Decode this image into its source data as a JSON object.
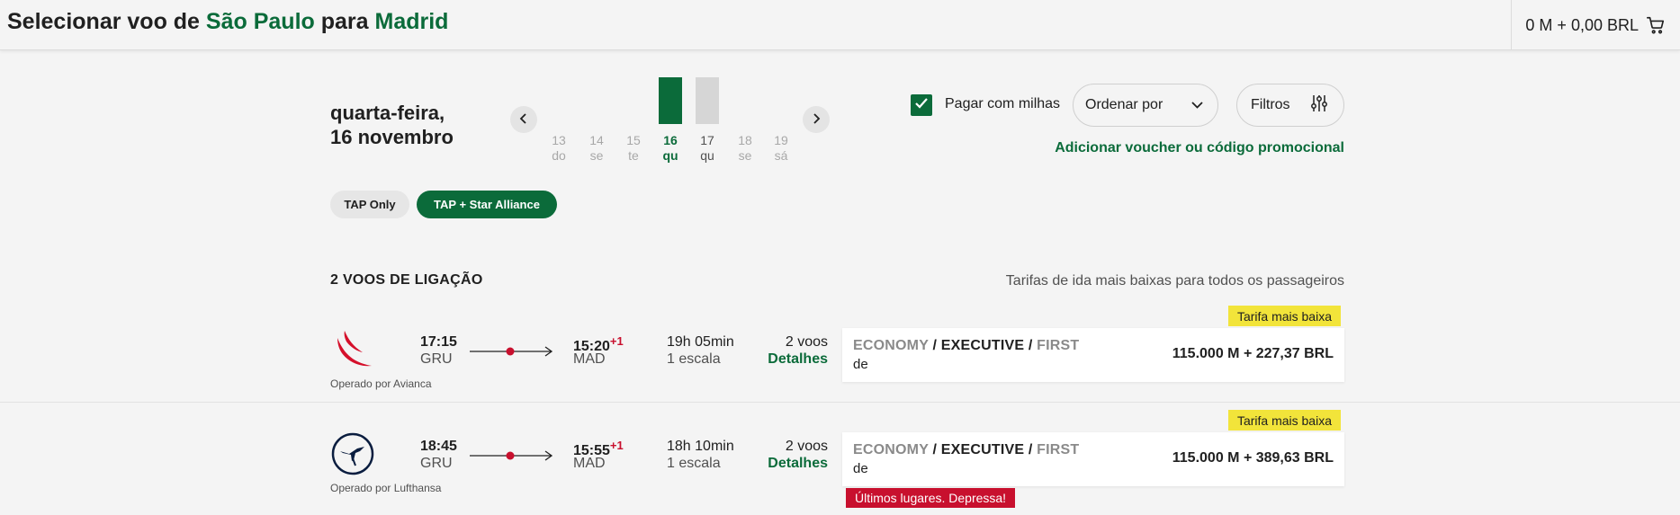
{
  "header": {
    "title_prefix": "Selecionar voo de ",
    "origin": "São Paulo",
    "title_mid": " para ",
    "destination": "Madrid",
    "cart_total": "0 M + 0,00 BRL",
    "cart_icon": "shopping-cart-icon"
  },
  "date_selector": {
    "weekday": "quarta-feira,",
    "date": "16 novembro",
    "days": [
      {
        "num": "13",
        "abbr": "do"
      },
      {
        "num": "14",
        "abbr": "se"
      },
      {
        "num": "15",
        "abbr": "te"
      },
      {
        "num": "16",
        "abbr": "qu"
      },
      {
        "num": "17",
        "abbr": "qu"
      },
      {
        "num": "18",
        "abbr": "se"
      },
      {
        "num": "19",
        "abbr": "sá"
      }
    ],
    "prev_icon": "chevron-left-icon",
    "next_icon": "chevron-right-icon"
  },
  "controls": {
    "pay_with_miles_label": "Pagar com milhas",
    "pay_with_miles_checked": true,
    "sort_label": "Ordenar por",
    "filters_label": "Filtros",
    "voucher_link": "Adicionar voucher ou código promocional"
  },
  "alliance": {
    "tap_only": "TAP Only",
    "tap_star": "TAP + Star Alliance"
  },
  "results": {
    "section_title": "2 VOOS DE LIGAÇÃO",
    "note": "Tarifas de ida mais baixas para todos os passageiros",
    "flights": [
      {
        "logo": "avianca-logo-icon",
        "operated_by": "Operado por Avianca",
        "dep_time": "17:15",
        "dep_code": "GRU",
        "arr_time": "15:20",
        "day_offset": "+1",
        "arr_code": "MAD",
        "duration": "19h 05min",
        "stops": "1 escala",
        "flights_count": "2 voos",
        "details": "Detalhes",
        "cabin_economy": "ECONOMY",
        "cabin_executive": "EXECUTIVE",
        "cabin_first": "FIRST",
        "sep": " / ",
        "from_label": "de",
        "price": "115.000 M + 227,37 BRL",
        "badge": "Tarifa mais baixa"
      },
      {
        "logo": "lufthansa-logo-icon",
        "operated_by": "Operado por Lufthansa",
        "dep_time": "18:45",
        "dep_code": "GRU",
        "arr_time": "15:55",
        "day_offset": "+1",
        "arr_code": "MAD",
        "duration": "18h 10min",
        "stops": "1 escala",
        "flights_count": "2 voos",
        "details": "Detalhes",
        "cabin_economy": "ECONOMY",
        "cabin_executive": "EXECUTIVE",
        "cabin_first": "FIRST",
        "sep": " / ",
        "from_label": "de",
        "price": "115.000 M + 389,63 BRL",
        "badge": "Tarifa mais baixa",
        "urgency": "Últimos lugares. Depressa!"
      }
    ]
  },
  "colors": {
    "brand_green": "#0b6b3a",
    "alert_red": "#c8102e",
    "badge_yellow": "#f2e43a"
  }
}
